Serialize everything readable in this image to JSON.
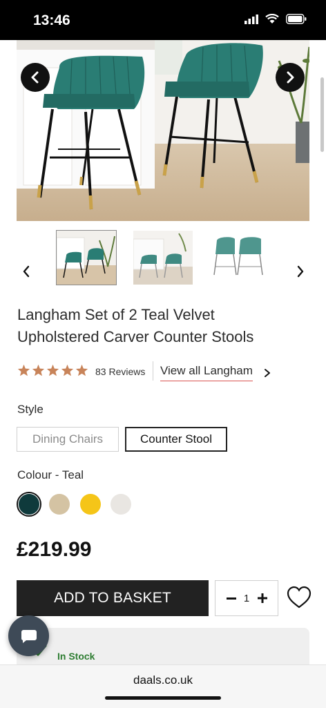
{
  "status_bar": {
    "time": "13:46"
  },
  "product": {
    "title_line1": "Langham Set of 2 Teal Velvet",
    "title_line2": "Upholstered Carver Counter Stools",
    "rating": 5,
    "reviews_label": "83 Reviews",
    "view_all_label": "View all Langham",
    "price": "£219.99"
  },
  "style": {
    "label": "Style",
    "options": [
      "Dining Chairs",
      "Counter Stool"
    ],
    "selected": "Counter Stool"
  },
  "colour": {
    "label": "Colour - Teal",
    "swatches": [
      "#0f3a3c",
      "#d4c3a3",
      "#f5c518",
      "#e9e6e2"
    ],
    "selected_index": 0
  },
  "purchase": {
    "add_to_basket_label": "ADD TO BASKET",
    "quantity": "1"
  },
  "stock": {
    "label": "In Stock"
  },
  "browser": {
    "domain": "daals.co.uk"
  },
  "icons": {
    "hero_prev": "chevron-left-icon",
    "hero_next": "chevron-right-icon",
    "wishlist": "heart-icon",
    "chat": "chat-icon",
    "stock": "check-icon"
  },
  "colors": {
    "teal": "#2a7d74",
    "star": "#c8845a",
    "accent_underline": "#d9534f",
    "stock_green": "#2e7d32"
  }
}
